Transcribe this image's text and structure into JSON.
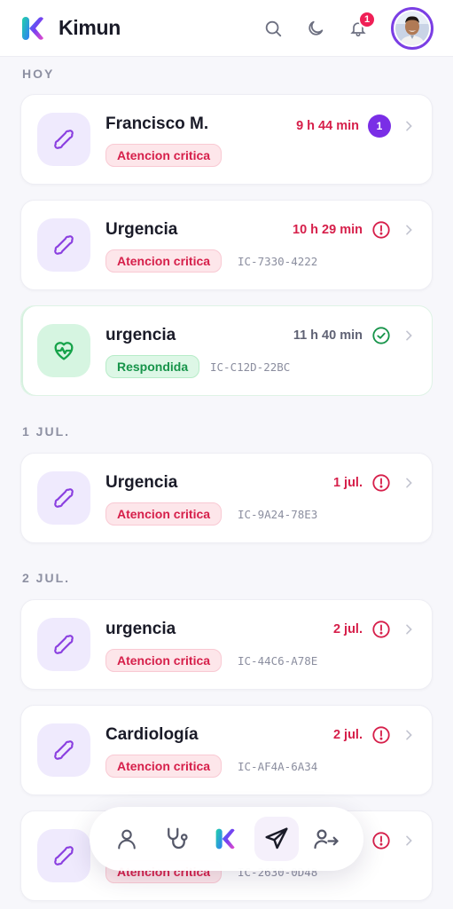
{
  "header": {
    "app_title": "Kimun",
    "notification_count": "1",
    "icons": [
      "search-icon",
      "moon-icon",
      "bell-icon"
    ]
  },
  "sections": [
    {
      "label": "HOY"
    },
    {
      "label": "1 JUL."
    },
    {
      "label": "2 JUL."
    }
  ],
  "cards": [
    {
      "title": "Francisco M.",
      "badge": "Atencion critica",
      "code": "",
      "time": "9 h 44 min",
      "count": "1",
      "status": "count",
      "icon": "bone-icon"
    },
    {
      "title": "Urgencia",
      "badge": "Atencion critica",
      "code": "IC-7330-4222",
      "time": "10 h 29 min",
      "status": "alert",
      "icon": "bone-icon"
    },
    {
      "title": "urgencia",
      "badge": "Respondida",
      "code": "IC-C12D-22BC",
      "time": "11 h 40 min",
      "status": "done",
      "icon": "heart-pulse-icon"
    },
    {
      "title": "Urgencia",
      "badge": "Atencion critica",
      "code": "IC-9A24-78E3",
      "time": "1 jul.",
      "status": "alert",
      "icon": "bone-icon"
    },
    {
      "title": "urgencia",
      "badge": "Atencion critica",
      "code": "IC-44C6-A78E",
      "time": "2 jul.",
      "status": "alert",
      "icon": "bone-icon"
    },
    {
      "title": "Cardiología",
      "badge": "Atencion critica",
      "code": "IC-AF4A-6A34",
      "time": "2 jul.",
      "status": "alert",
      "icon": "bone-icon"
    },
    {
      "title": "",
      "badge": "Atencion critica",
      "code": "IC-2630-0D48",
      "time": "",
      "status": "alert",
      "icon": "bone-icon"
    }
  ],
  "bottom_nav": [
    {
      "name": "user-icon"
    },
    {
      "name": "stethoscope-icon"
    },
    {
      "name": "kimun-logo-icon"
    },
    {
      "name": "send-icon",
      "active": true
    },
    {
      "name": "logout-icon"
    }
  ],
  "colors": {
    "accent": "#7a2ee6",
    "critical": "#d61f4a",
    "success": "#17944a"
  }
}
